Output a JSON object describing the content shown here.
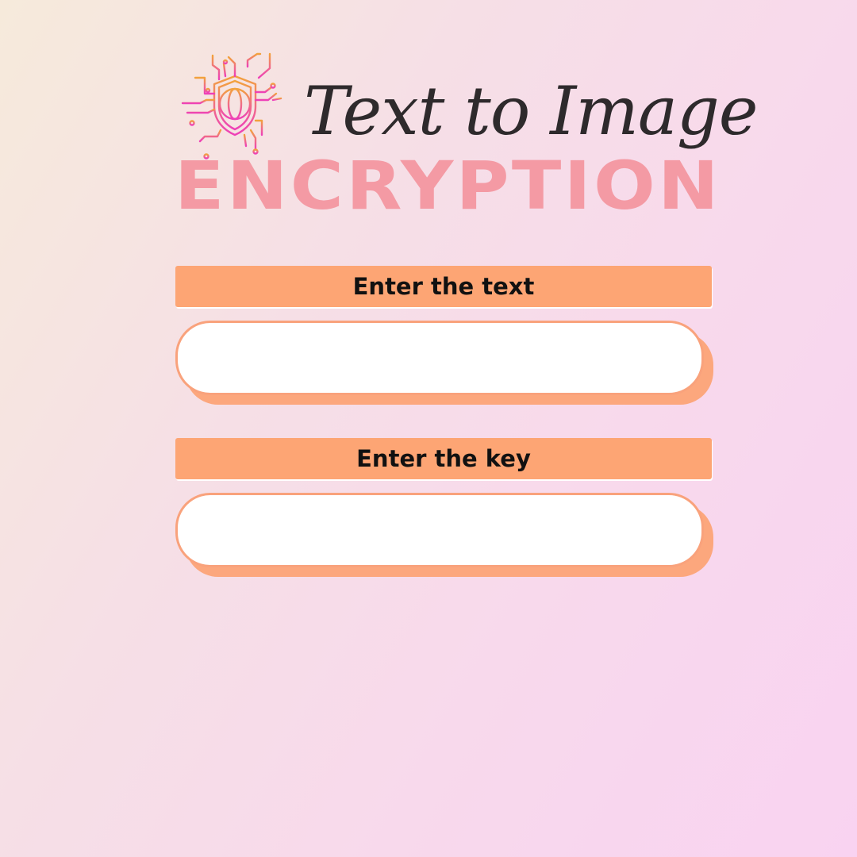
{
  "header": {
    "script_title": "Text to Image",
    "block_title": "ENCRYPTION",
    "logo_icon": "shield-globe-circuit-icon"
  },
  "form": {
    "text_label": "Enter the text",
    "text_value": "",
    "key_label": "Enter the key",
    "key_value": ""
  },
  "colors": {
    "label_bar": "#fda574",
    "field_shadow": "#fca77d",
    "title_block": "#f49aa4",
    "logo_orange": "#f2a23c",
    "logo_pink": "#ee3fb8"
  }
}
